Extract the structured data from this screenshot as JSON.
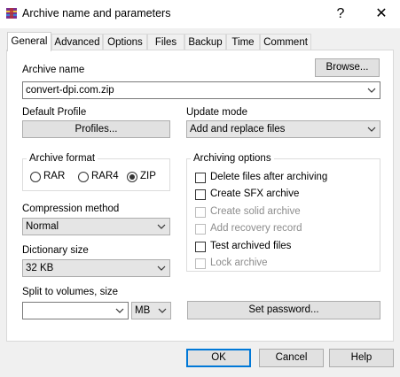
{
  "window": {
    "title": "Archive name and parameters",
    "help_glyph": "?",
    "close_glyph": "✕"
  },
  "tabs": [
    {
      "label": "General",
      "active": true
    },
    {
      "label": "Advanced"
    },
    {
      "label": "Options"
    },
    {
      "label": "Files"
    },
    {
      "label": "Backup"
    },
    {
      "label": "Time"
    },
    {
      "label": "Comment"
    }
  ],
  "general": {
    "archive_name_label": "Archive name",
    "browse_button": "Browse...",
    "archive_name_value": "convert-dpi.com.zip",
    "default_profile_label": "Default Profile",
    "profiles_button": "Profiles...",
    "update_mode_label": "Update mode",
    "update_mode_value": "Add and replace files",
    "archive_format": {
      "title": "Archive format",
      "options": [
        "RAR",
        "RAR4",
        "ZIP"
      ],
      "selected": "ZIP"
    },
    "archiving_options": {
      "title": "Archiving options",
      "items": [
        {
          "label": "Delete files after archiving",
          "checked": false,
          "enabled": true
        },
        {
          "label": "Create SFX archive",
          "checked": false,
          "enabled": true
        },
        {
          "label": "Create solid archive",
          "checked": false,
          "enabled": false
        },
        {
          "label": "Add recovery record",
          "checked": false,
          "enabled": false
        },
        {
          "label": "Test archived files",
          "checked": false,
          "enabled": true
        },
        {
          "label": "Lock archive",
          "checked": false,
          "enabled": false
        }
      ]
    },
    "compression_method_label": "Compression method",
    "compression_method_value": "Normal",
    "dictionary_size_label": "Dictionary size",
    "dictionary_size_value": "32 KB",
    "split_label": "Split to volumes, size",
    "split_value": "",
    "split_unit": "MB",
    "set_password_button": "Set password..."
  },
  "footer": {
    "ok": "OK",
    "cancel": "Cancel",
    "help": "Help"
  },
  "colors": {
    "default_button_border": "#0078d7"
  }
}
